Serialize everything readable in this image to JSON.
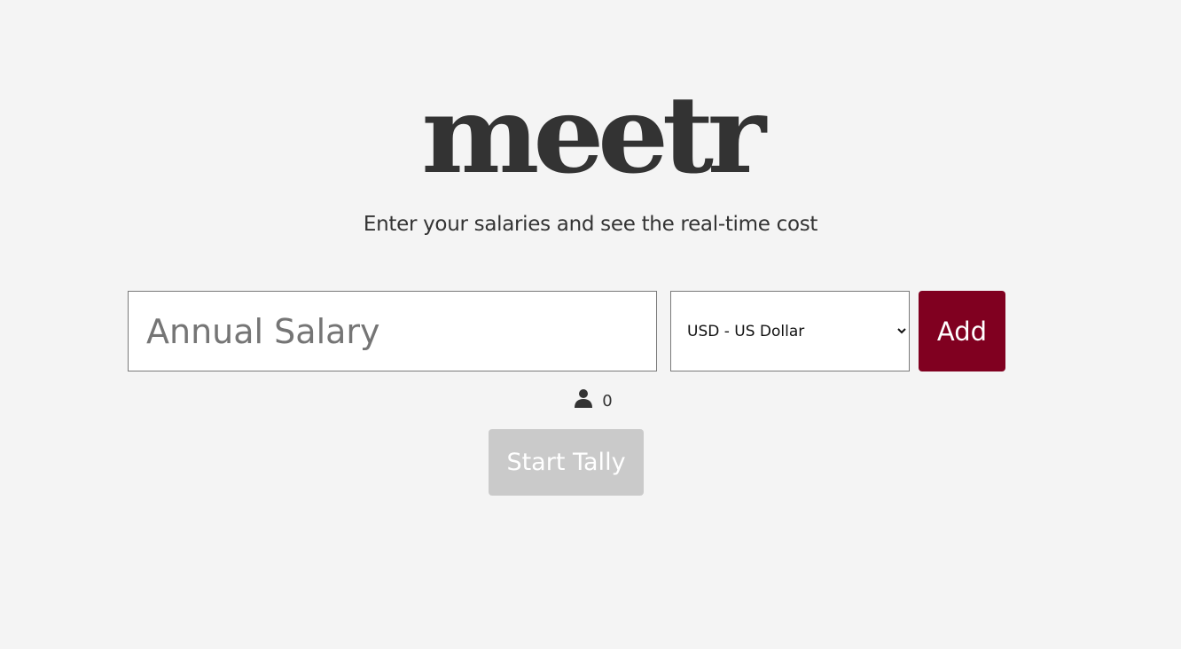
{
  "brand": {
    "logo": "meetr",
    "tagline": "Enter your salaries and see the real-time cost"
  },
  "form": {
    "salary_placeholder": "Annual Salary",
    "salary_value": "",
    "currency_selected": "USD - US Dollar",
    "add_label": "Add"
  },
  "attendees": {
    "icon": "person-icon",
    "count": "0"
  },
  "actions": {
    "start_label": "Start Tally",
    "start_disabled": true
  },
  "colors": {
    "background": "#f4f4f4",
    "text": "#333333",
    "accent": "#800020",
    "disabled": "#cacaca"
  }
}
